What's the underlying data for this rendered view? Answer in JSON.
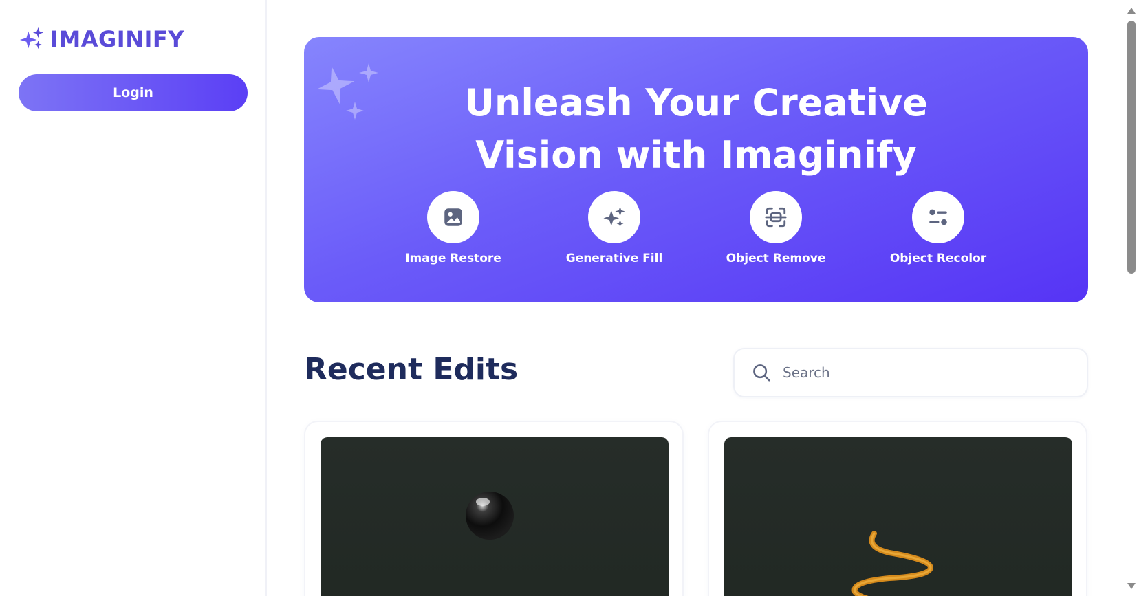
{
  "app": {
    "logo_text": "IMAGINIFY",
    "brand_color": "#5a4bd8",
    "accent_gradient": [
      "#7d74f5",
      "#5634f5"
    ]
  },
  "sidebar": {
    "login_label": "Login"
  },
  "hero": {
    "title_line1": "Unleash Your Creative",
    "title_line2": "Vision with Imaginify",
    "tools": [
      {
        "label": "Image Restore",
        "icon": "image-icon"
      },
      {
        "label": "Generative Fill",
        "icon": "sparkles-icon"
      },
      {
        "label": "Object Remove",
        "icon": "scan-icon"
      },
      {
        "label": "Object Recolor",
        "icon": "filter-icon"
      }
    ]
  },
  "recent": {
    "title": "Recent Edits",
    "search": {
      "placeholder": "Search",
      "value": "",
      "icon": "search-icon"
    },
    "cards": [
      {
        "image": "black glossy sphere on dark green background"
      },
      {
        "image": "orange spring coil on dark green background"
      }
    ]
  }
}
